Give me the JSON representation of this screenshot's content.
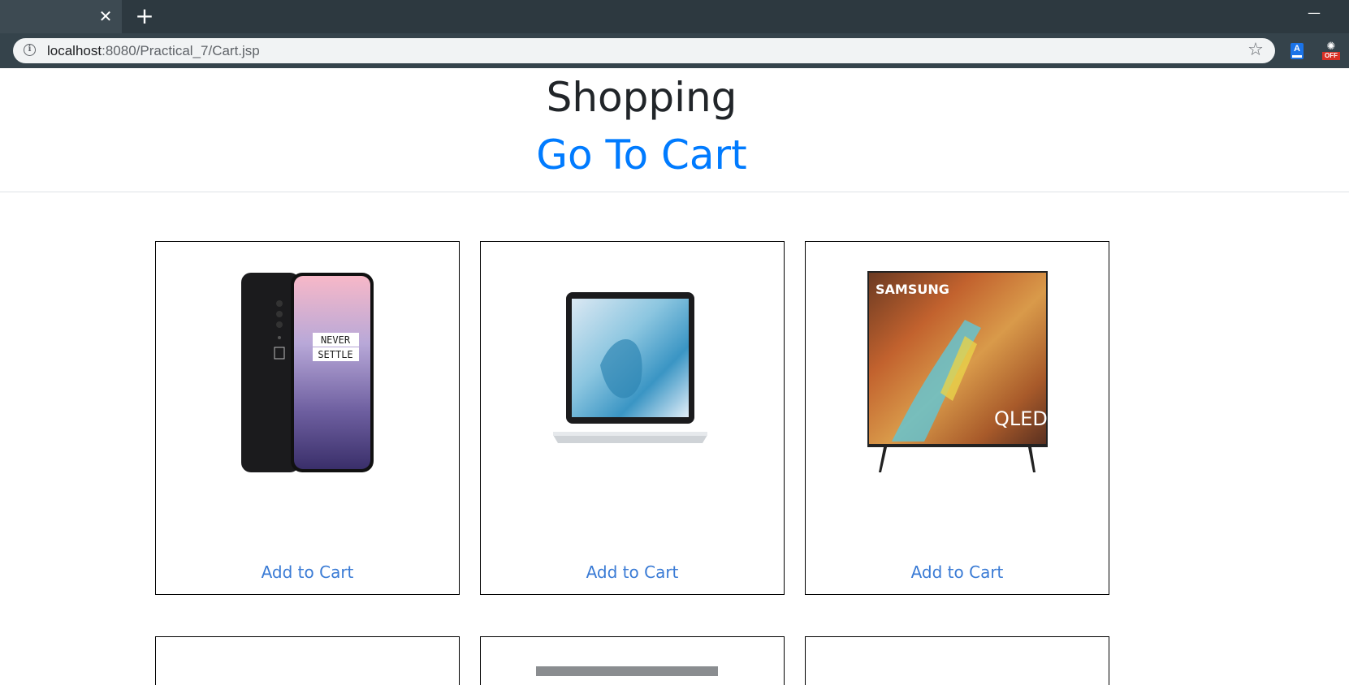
{
  "browser": {
    "url_host": "localhost",
    "url_path": ":8080/Practical_7/Cart.jsp",
    "tab_close": "✕",
    "new_tab": "+",
    "minimize": "—",
    "star": "☆",
    "ext1_letter": "A",
    "ext2_badge": "OFF",
    "icons": [
      "close-icon",
      "plus-icon",
      "minimize-icon",
      "info-icon",
      "star-icon",
      "extension-icon",
      "extension-off-icon"
    ]
  },
  "page": {
    "title": "Shopping",
    "cart_link": "Go To Cart",
    "accent_color": "#007bff"
  },
  "products": [
    {
      "name": "oneplus-phone",
      "image_text": [
        "NEVER",
        "SETTLE"
      ],
      "button": "Add to Cart"
    },
    {
      "name": "macbook-air",
      "button": "Add to Cart"
    },
    {
      "name": "samsung-qled-tv",
      "image_text": [
        "SAMSUNG",
        "QLED"
      ],
      "button": "Add to Cart"
    }
  ]
}
